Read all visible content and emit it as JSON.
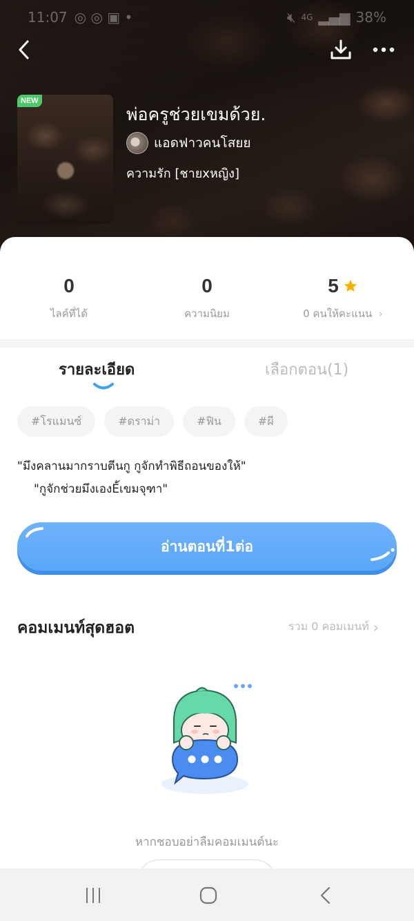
{
  "status_bar": {
    "time": "11:07",
    "battery": "38%",
    "network": "4G"
  },
  "header": {
    "back_icon": "chevron-left-icon",
    "download_icon": "download-icon",
    "more_icon": "more-horizontal-icon"
  },
  "book": {
    "badge": "NEW",
    "title": "พ่อครูช่วยเขมด้วย.",
    "author": "แอดฟาวคนโสยย",
    "genre": "ความรัก [ชายxหญิง]"
  },
  "stats": {
    "likes_value": "0",
    "likes_label": "ไลค์ที่ได้",
    "popularity_value": "0",
    "popularity_label": "ความนิยม",
    "rating_value": "5",
    "rating_label": "0 คนให้คะแนน"
  },
  "tabs": {
    "detail": "รายละเอียด",
    "episodes": "เลือกตอน(1)"
  },
  "tags": [
    "#โรแมนซ์",
    "#ดราม่า",
    "#ฟิน",
    "#ผี"
  ],
  "synopsis": {
    "line1": "\"มึงคลานมากราบตีนกู กูจักทำพิธีถอนของให้\"",
    "line2": "\"กูจักช่วยมึงเองÈ้เขมจุฑา\""
  },
  "read_button": "อ่านตอนที่1ต่อ",
  "comments": {
    "title": "คอมเมนท์สุดฮอต",
    "total": "รวม 0 คอมเมนท์",
    "empty_text": "หากชอบอย่าลืมคอมเมนต์นะ"
  },
  "colors": {
    "accent": "#5aa6f8",
    "badge": "#4cc86b",
    "star": "#f5b300",
    "mascot_hair": "#67d9a8"
  }
}
